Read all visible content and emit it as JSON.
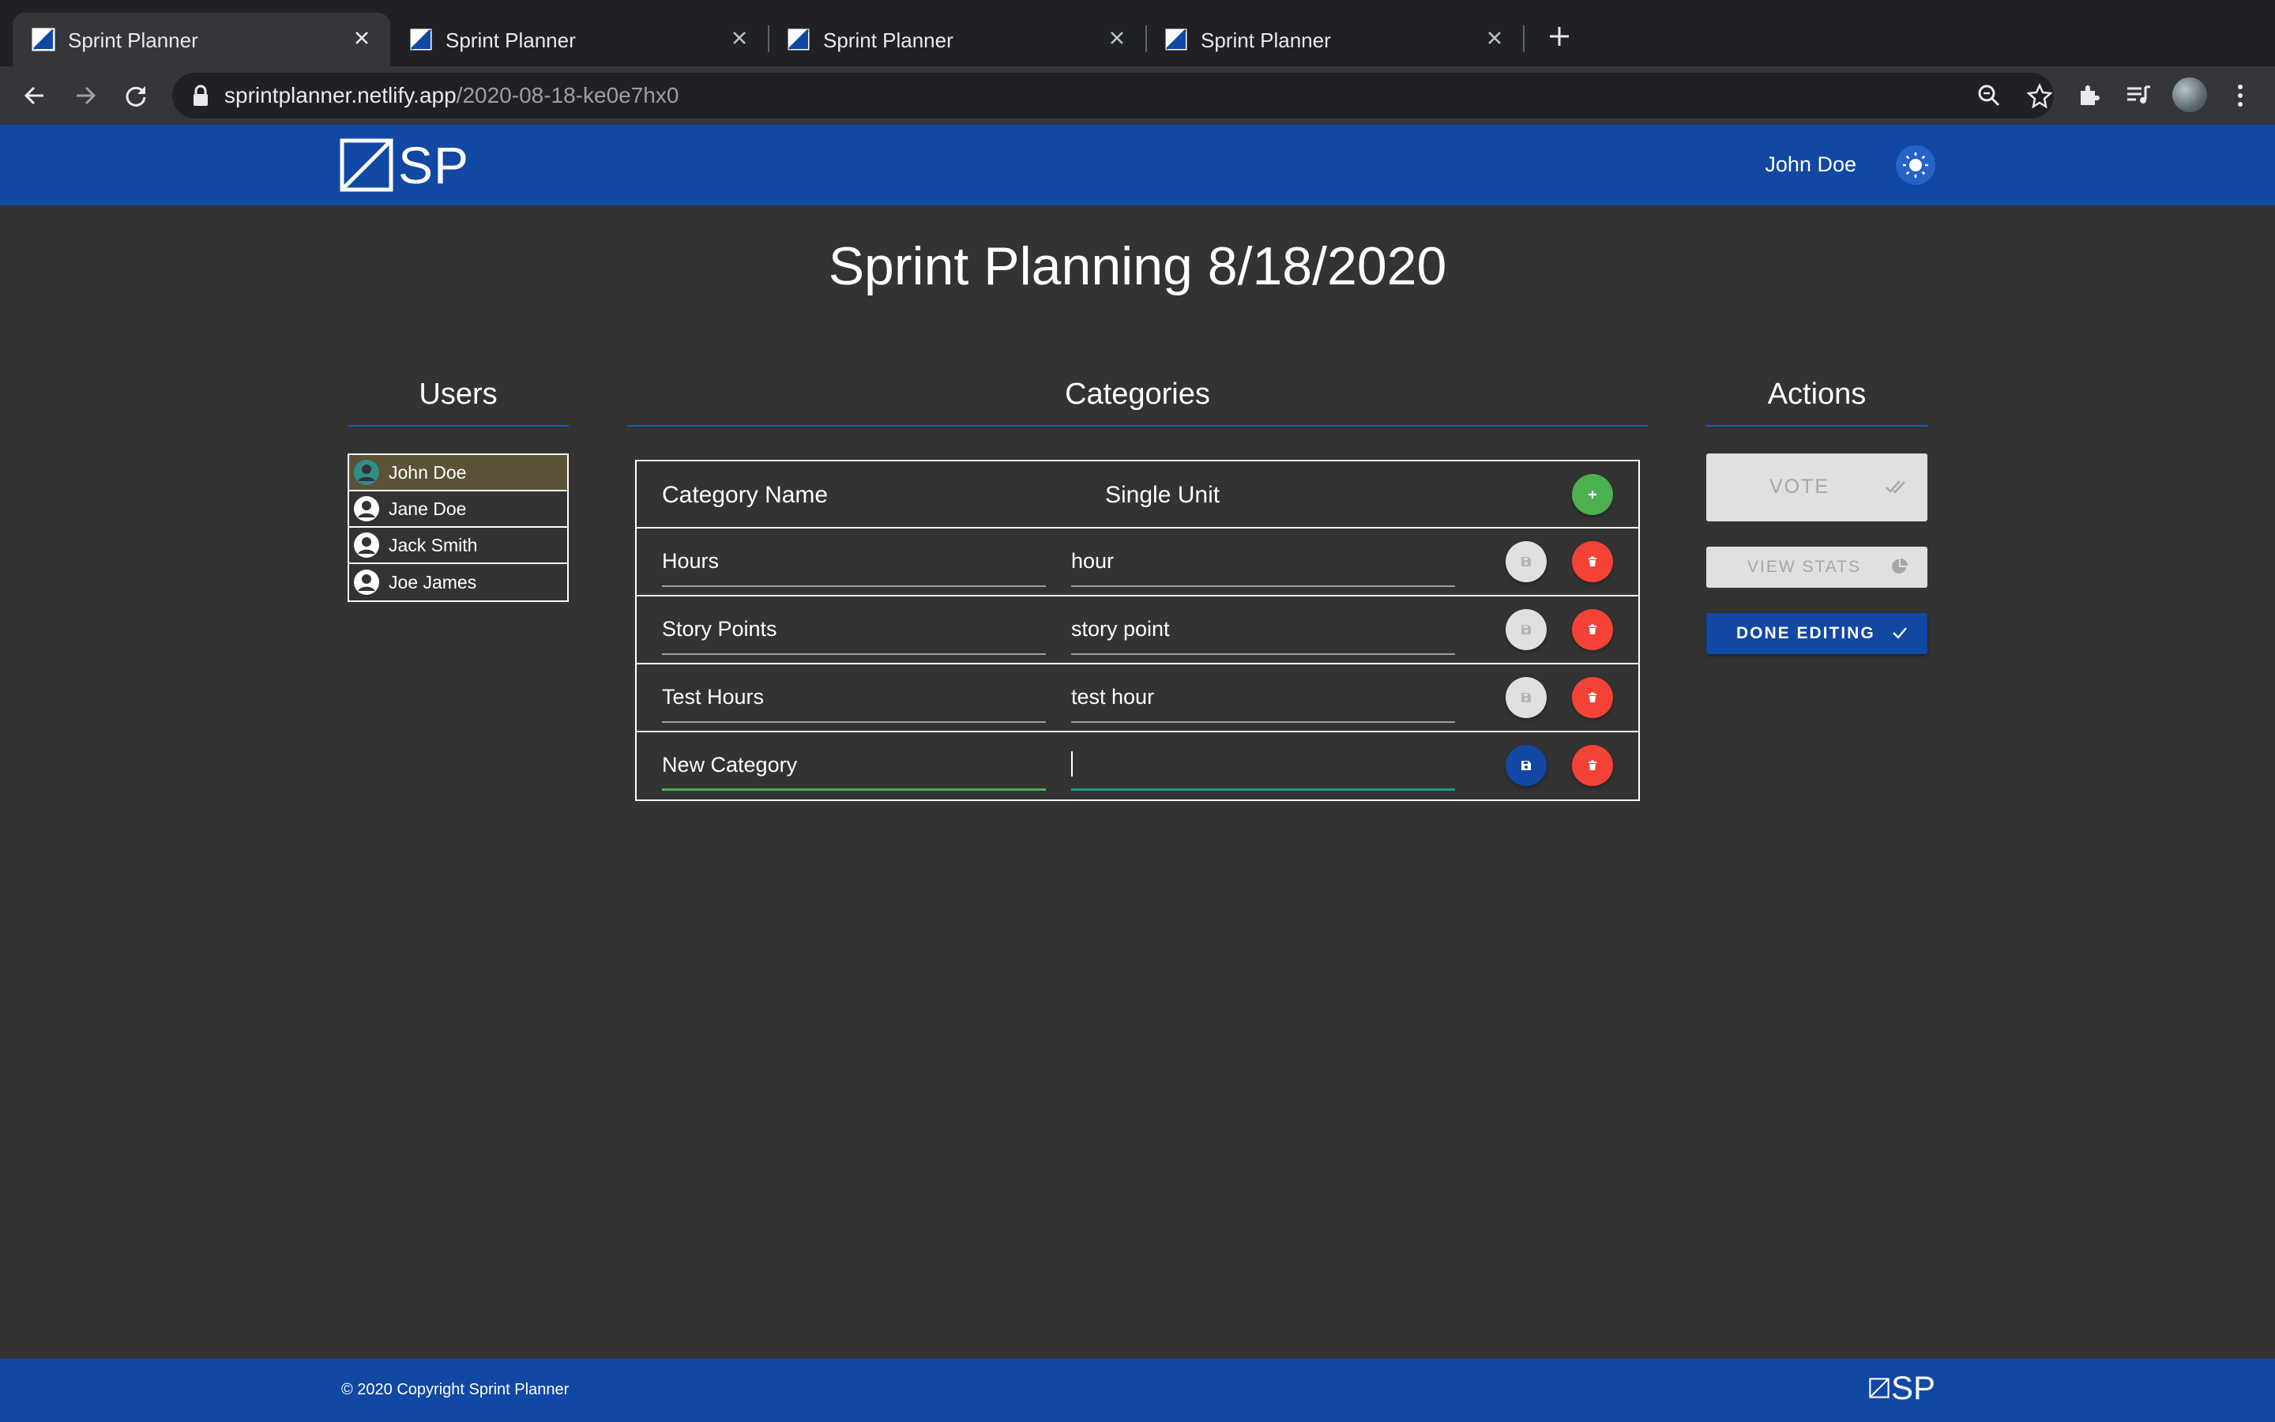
{
  "browser": {
    "tabs": [
      {
        "title": "Sprint Planner",
        "active": true
      },
      {
        "title": "Sprint Planner",
        "active": false
      },
      {
        "title": "Sprint Planner",
        "active": false
      },
      {
        "title": "Sprint Planner",
        "active": false
      }
    ],
    "url_domain": "sprintplanner.netlify.app",
    "url_path": "/2020-08-18-ke0e7hx0"
  },
  "header": {
    "logo_text": "SP",
    "user_name": "John Doe",
    "theme_icon": "sun-icon"
  },
  "page": {
    "title": "Sprint Planning 8/18/2020"
  },
  "users": {
    "heading": "Users",
    "items": [
      {
        "name": "John Doe",
        "current": true
      },
      {
        "name": "Jane Doe",
        "current": false
      },
      {
        "name": "Jack Smith",
        "current": false
      },
      {
        "name": "Joe James",
        "current": false
      }
    ]
  },
  "categories": {
    "heading": "Categories",
    "col_name": "Category Name",
    "col_unit": "Single Unit",
    "rows": [
      {
        "name": "Hours",
        "unit": "hour"
      },
      {
        "name": "Story Points",
        "unit": "story point"
      },
      {
        "name": "Test Hours",
        "unit": "test hour"
      },
      {
        "name": "New Category",
        "unit": ""
      }
    ]
  },
  "actions": {
    "heading": "Actions",
    "vote_label": "VOTE",
    "stats_label": "VIEW STATS",
    "done_label": "DONE EDITING"
  },
  "footer": {
    "copyright": "© 2020 Copyright Sprint Planner",
    "logo_text": "SP"
  },
  "colors": {
    "brand_blue": "#1148a3",
    "background": "#333333",
    "add_green": "#4caf50",
    "delete_red": "#f44336"
  }
}
